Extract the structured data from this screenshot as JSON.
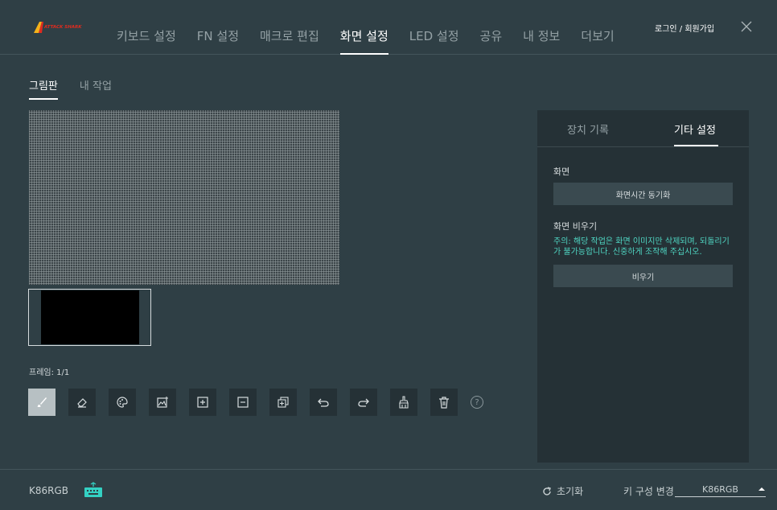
{
  "colors": {
    "background": "#2f3f45",
    "panel": "#253136",
    "accent_warning": "#4fd6c3",
    "logo_red": "#e02b1f",
    "logo_yellow": "#f5b21a",
    "keyboard_icon": "#34d1c3"
  },
  "nav": {
    "items": [
      {
        "label": "키보드 설정"
      },
      {
        "label": "FN 설정"
      },
      {
        "label": "매크로 편집"
      },
      {
        "label": "화면 설정"
      },
      {
        "label": "LED 설정"
      },
      {
        "label": "공유"
      },
      {
        "label": "내 정보"
      },
      {
        "label": "더보기"
      }
    ],
    "active_index": 3,
    "login_label": "로그인 / 회원가입",
    "close_icon": "close-icon"
  },
  "subtabs": {
    "items": [
      {
        "label": "그림판"
      },
      {
        "label": "내 작업"
      }
    ],
    "active_index": 0
  },
  "editor": {
    "frame_label": "프레임: 1/1",
    "tools": [
      "brush-icon",
      "eraser-icon",
      "palette-icon",
      "image-icon",
      "add-frame-icon",
      "remove-frame-icon",
      "duplicate-frame-icon",
      "undo-icon",
      "redo-icon",
      "fill-icon",
      "trash-icon"
    ],
    "help": "?"
  },
  "panel": {
    "tabs": [
      {
        "label": "장치 기록"
      },
      {
        "label": "기타 설정"
      }
    ],
    "active_index": 1,
    "screen_label": "화면",
    "sync_button": "화면시간 동기화",
    "clear_label": "화면 비우기",
    "warning": "주의: 해당 작업은 화면 이미지만 삭제되며, 되돌리기가 불가능합니다. 신중하게 조작해 주십시오.",
    "clear_button": "비우기"
  },
  "bottom": {
    "model": "K86RGB",
    "reset_label": "초기화",
    "config_label": "키 구성 변경",
    "config_value": "K86RGB"
  }
}
